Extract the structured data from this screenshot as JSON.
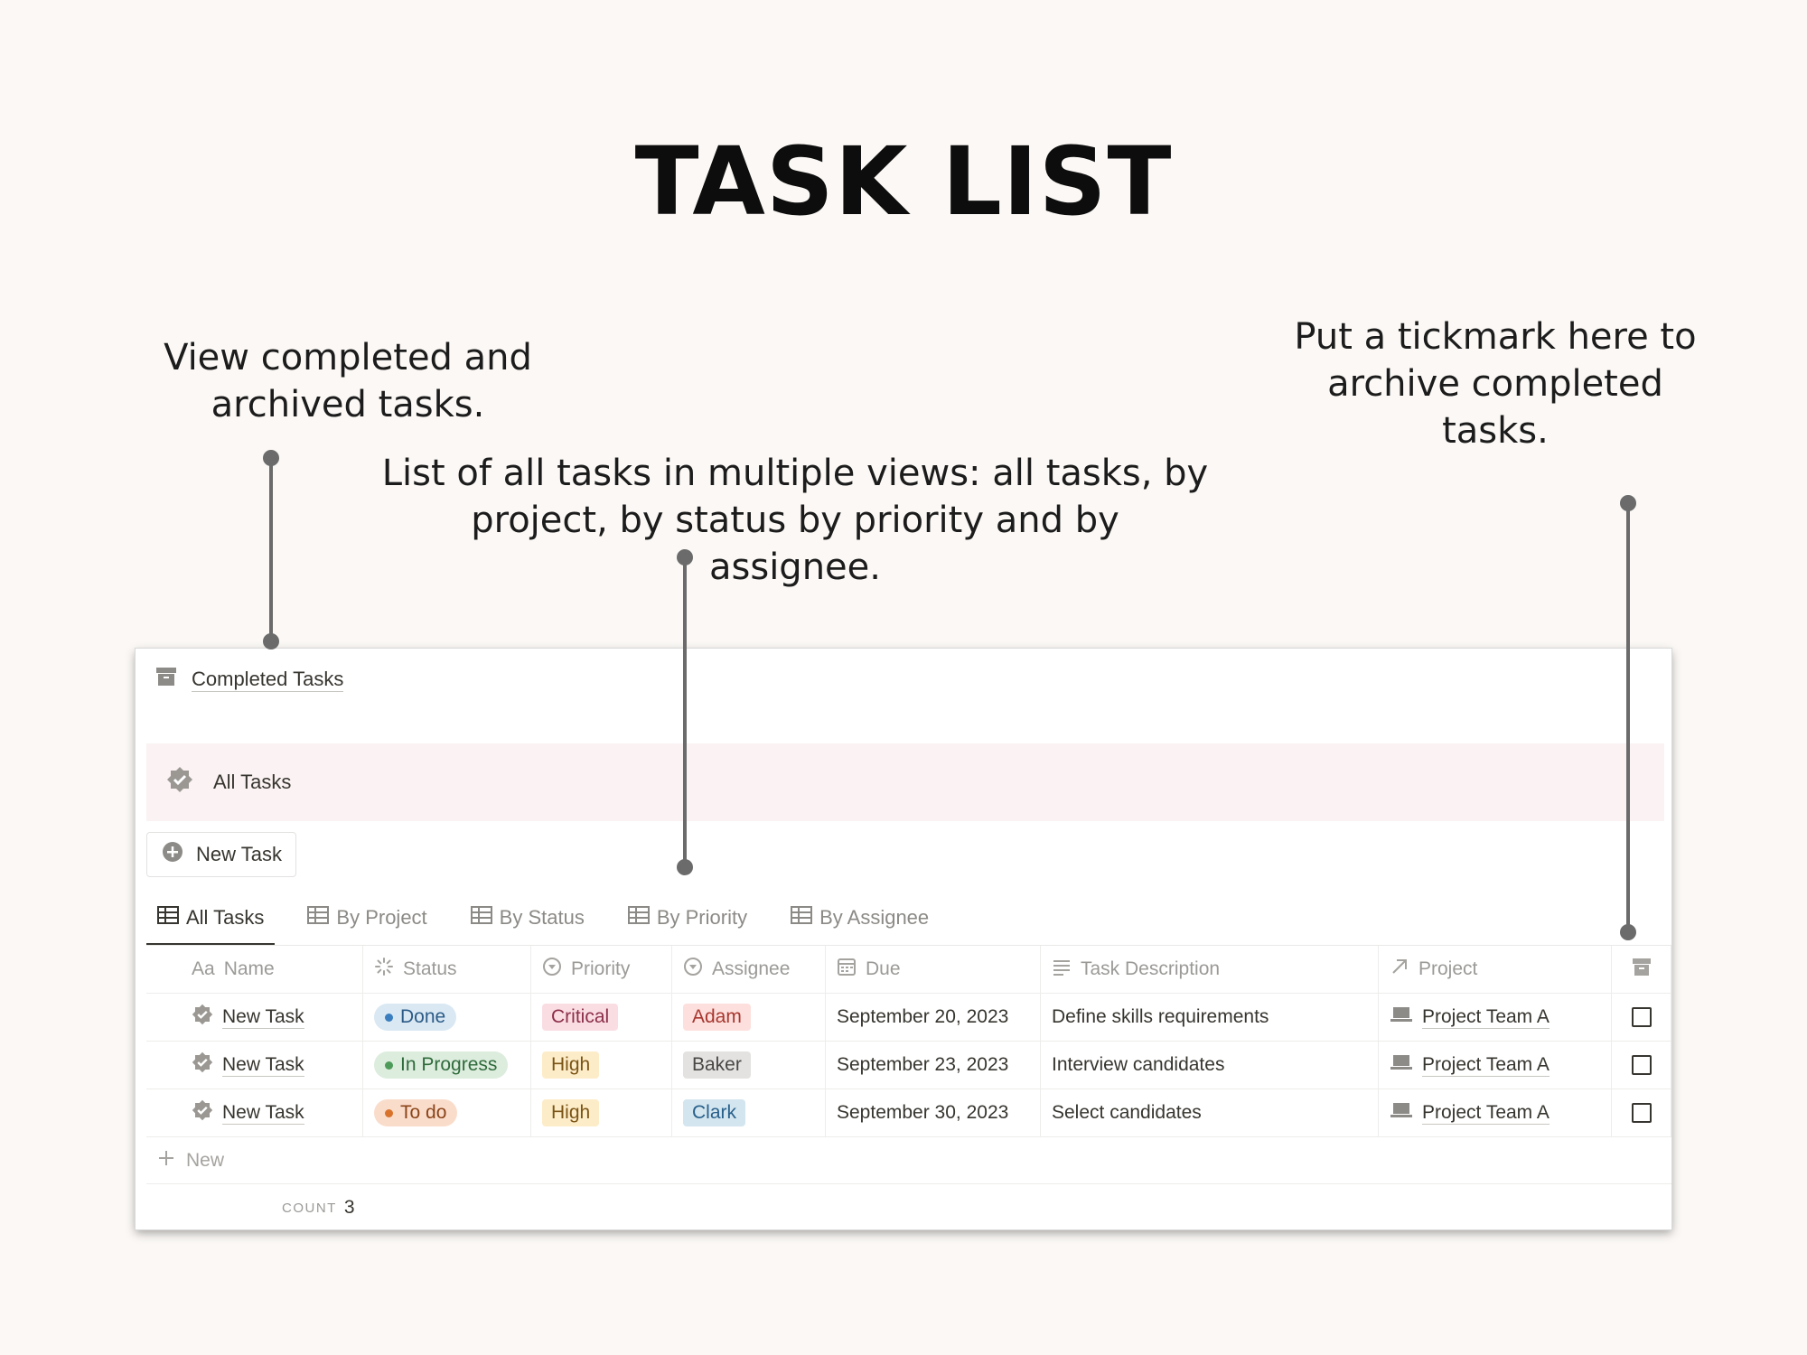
{
  "title": "TASK LIST",
  "annotations": {
    "left": "View completed and archived tasks.",
    "middle": "List of all tasks in multiple views: all tasks, by project, by status by priority and by assignee.",
    "right": "Put a tickmark here to archive completed tasks."
  },
  "panel": {
    "completed_link": "Completed Tasks",
    "banner_title": "All Tasks",
    "new_task_button": "New Task",
    "tabs": [
      {
        "label": "All Tasks",
        "active": true
      },
      {
        "label": "By Project",
        "active": false
      },
      {
        "label": "By Status",
        "active": false
      },
      {
        "label": "By Priority",
        "active": false
      },
      {
        "label": "By Assignee",
        "active": false
      }
    ],
    "columns": {
      "name_prefix": "Aa",
      "name": "Name",
      "status": "Status",
      "priority": "Priority",
      "assignee": "Assignee",
      "due": "Due",
      "description": "Task Description",
      "project": "Project"
    },
    "rows": [
      {
        "name": "New Task",
        "status": "Done",
        "priority": "Critical",
        "assignee": "Adam",
        "due": "September 20, 2023",
        "description": "Define skills requirements",
        "project": "Project Team A",
        "archived": false
      },
      {
        "name": "New Task",
        "status": "In Progress",
        "priority": "High",
        "assignee": "Baker",
        "due": "September 23, 2023",
        "description": "Interview candidates",
        "project": "Project Team A",
        "archived": false
      },
      {
        "name": "New Task",
        "status": "To do",
        "priority": "High",
        "assignee": "Clark",
        "due": "September 30, 2023",
        "description": "Select candidates",
        "project": "Project Team A",
        "archived": false
      }
    ],
    "new_row_label": "New",
    "count_label": "COUNT",
    "count_value": "3"
  },
  "colors": {
    "status_done_bg": "#d9e8f3",
    "status_done_dot": "#3a7ebf",
    "status_inprogress_bg": "#dcecdd",
    "status_inprogress_dot": "#4d9b5a",
    "status_todo_bg": "#fadccb",
    "status_todo_dot": "#d9732c",
    "priority_critical_bg": "#fadde3",
    "priority_high_bg": "#fdecc8",
    "assignee_adam_bg": "#fde0dd",
    "assignee_baker_bg": "#e3e2e0",
    "assignee_clark_bg": "#d3e5ef",
    "banner_bg": "#fbf2f3"
  },
  "icons": {
    "completed_link": "archive-box-icon",
    "banner": "verified-badge-icon",
    "new_task": "plus-circle-icon",
    "tab": "table-icon",
    "status_col": "spinner-icon",
    "priority_col": "select-circle-icon",
    "assignee_col": "select-circle-icon",
    "due_col": "calendar-icon",
    "desc_col": "text-lines-icon",
    "project_col": "arrow-up-right-icon",
    "archive_col": "archive-box-icon",
    "row_name": "verified-badge-icon",
    "project_page": "laptop-icon"
  }
}
